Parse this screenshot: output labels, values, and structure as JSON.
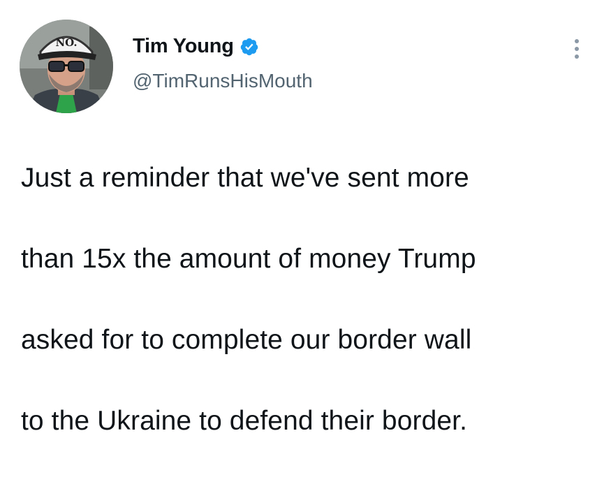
{
  "tweet": {
    "author": {
      "display_name": "Tim Young",
      "handle": "@TimRunsHisMouth",
      "verified": true,
      "avatar_cap_text": "NO."
    },
    "menu_icon": "more-vertical-icon",
    "text_lines": [
      "Just a reminder that we've sent more",
      "than 15x the amount of money Trump",
      "asked for to complete our border wall",
      "to the Ukraine to defend their border."
    ]
  },
  "colors": {
    "text": "#0f1419",
    "secondary": "#536471",
    "verified": "#1d9bf0",
    "background": "#ffffff"
  }
}
